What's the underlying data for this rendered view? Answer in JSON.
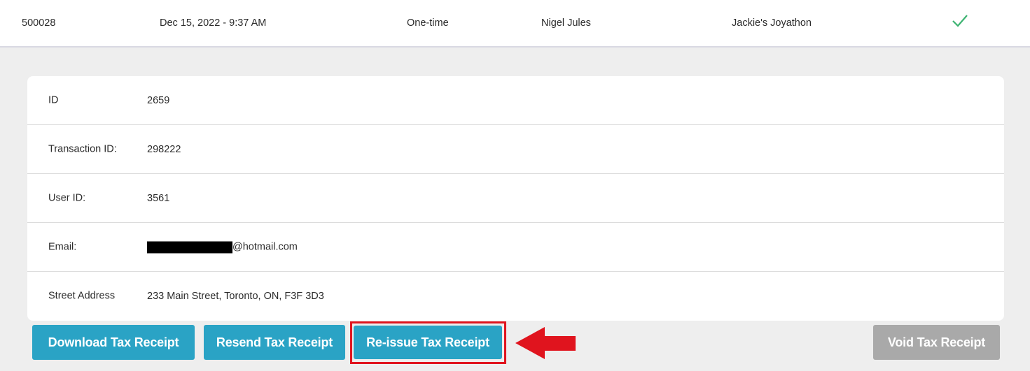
{
  "transaction_row": {
    "number": "500028",
    "date": "Dec 15, 2022 - 9:37 AM",
    "type": "One-time",
    "donor": "Nigel Jules",
    "campaign": "Jackie's Joyathon",
    "status_icon": "check-icon",
    "status_color": "#3cb371"
  },
  "details": [
    {
      "label": "ID",
      "value": "2659"
    },
    {
      "label": "Transaction ID:",
      "value": "298222"
    },
    {
      "label": "User ID:",
      "value": "3561"
    },
    {
      "label": "Email:",
      "value": "@hotmail.com",
      "redacted_prefix": true
    },
    {
      "label": "Street Address",
      "value": "233 Main Street, Toronto, ON, F3F 3D3"
    }
  ],
  "actions": {
    "download_label": "Download Tax Receipt",
    "resend_label": "Resend Tax Receipt",
    "reissue_label": "Re-issue Tax Receipt",
    "void_label": "Void Tax Receipt"
  },
  "colors": {
    "primary": "#2aa3c5",
    "disabled": "#a9a9a9",
    "annotation": "#e0141e"
  },
  "annotation_icon": "left-arrow-icon"
}
